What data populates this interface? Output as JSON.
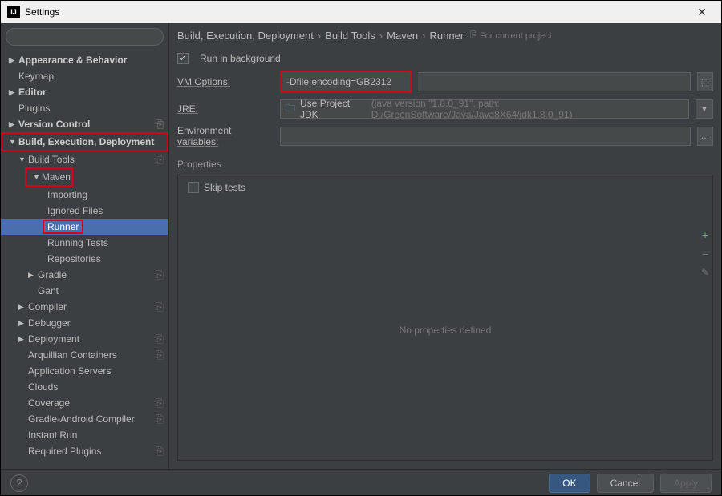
{
  "window": {
    "title": "Settings"
  },
  "sidebar": {
    "search_placeholder": "",
    "items": [
      {
        "label": "Appearance & Behavior",
        "arrow": "▶",
        "bold": true
      },
      {
        "label": "Keymap"
      },
      {
        "label": "Editor",
        "arrow": "▶",
        "bold": true
      },
      {
        "label": "Plugins"
      },
      {
        "label": "Version Control",
        "arrow": "▶",
        "bold": true,
        "badge": true
      },
      {
        "label": "Build, Execution, Deployment",
        "arrow": "▼",
        "bold": true,
        "red": true
      }
    ],
    "build_tools": {
      "label": "Build Tools",
      "arrow": "▼",
      "badge": true
    },
    "maven": {
      "label": "Maven",
      "arrow": "▼",
      "badge": true,
      "red": true
    },
    "maven_children": [
      {
        "label": "Importing"
      },
      {
        "label": "Ignored Files"
      },
      {
        "label": "Runner",
        "selected": true,
        "red": true
      },
      {
        "label": "Running Tests"
      },
      {
        "label": "Repositories"
      }
    ],
    "gradle": {
      "label": "Gradle",
      "arrow": "▶",
      "badge": true
    },
    "gant": {
      "label": "Gant"
    },
    "rest": [
      {
        "label": "Compiler",
        "arrow": "▶",
        "badge": true
      },
      {
        "label": "Debugger",
        "arrow": "▶"
      },
      {
        "label": "Deployment",
        "arrow": "▶",
        "badge": true
      }
    ],
    "deployment_children": [
      {
        "label": "Arquillian Containers",
        "badge": true
      },
      {
        "label": "Application Servers"
      },
      {
        "label": "Clouds"
      },
      {
        "label": "Coverage",
        "badge": true
      },
      {
        "label": "Gradle-Android Compiler",
        "badge": true
      },
      {
        "label": "Instant Run"
      },
      {
        "label": "Required Plugins",
        "badge": true
      }
    ]
  },
  "breadcrumb": {
    "p1": "Build, Execution, Deployment",
    "p2": "Build Tools",
    "p3": "Maven",
    "p4": "Runner",
    "scope": "For current project"
  },
  "form": {
    "run_bg_label": "Run in background",
    "vm_label": "VM Options:",
    "vm_value": "-Dfile.encoding=GB2312",
    "jre_label": "JRE:",
    "jre_value": "Use Project JDK",
    "jre_hint": "(java version \"1.8.0_91\", path: D:/GreenSoftware/Java/Java8X64/jdk1.8.0_91)",
    "env_label": "Environment variables:",
    "env_value": "",
    "properties_title": "Properties",
    "skip_tests_label": "Skip tests",
    "no_properties": "No properties defined"
  },
  "footer": {
    "ok": "OK",
    "cancel": "Cancel",
    "apply": "Apply"
  }
}
